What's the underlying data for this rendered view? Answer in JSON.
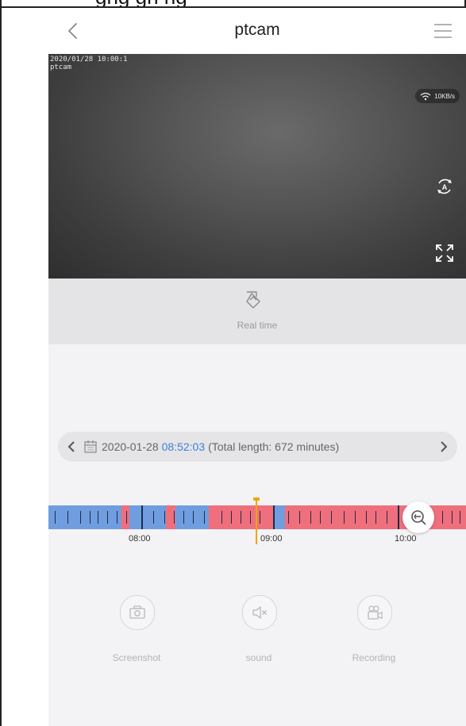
{
  "app": {
    "title": "ptcam"
  },
  "video": {
    "osd_time": "2020/01/28 10:00:1",
    "osd_name": "ptcam",
    "network_speed": "10KB/s"
  },
  "realtime": {
    "label": "Real time"
  },
  "playback": {
    "date": "2020-01-28",
    "time": "08:52:03",
    "length_text": "(Total length: 672 minutes)"
  },
  "timeline": {
    "labels": [
      "08:00",
      "09:00",
      "10:00"
    ],
    "colors": {
      "motion": "#ef6f7d",
      "normal": "#6f9de0",
      "cursor": "#f0a500"
    }
  },
  "actions": [
    {
      "label": "Screenshot",
      "icon": "camera-icon"
    },
    {
      "label": "sound",
      "icon": "speaker-muted-icon"
    },
    {
      "label": "Recording",
      "icon": "video-recorder-icon"
    }
  ]
}
